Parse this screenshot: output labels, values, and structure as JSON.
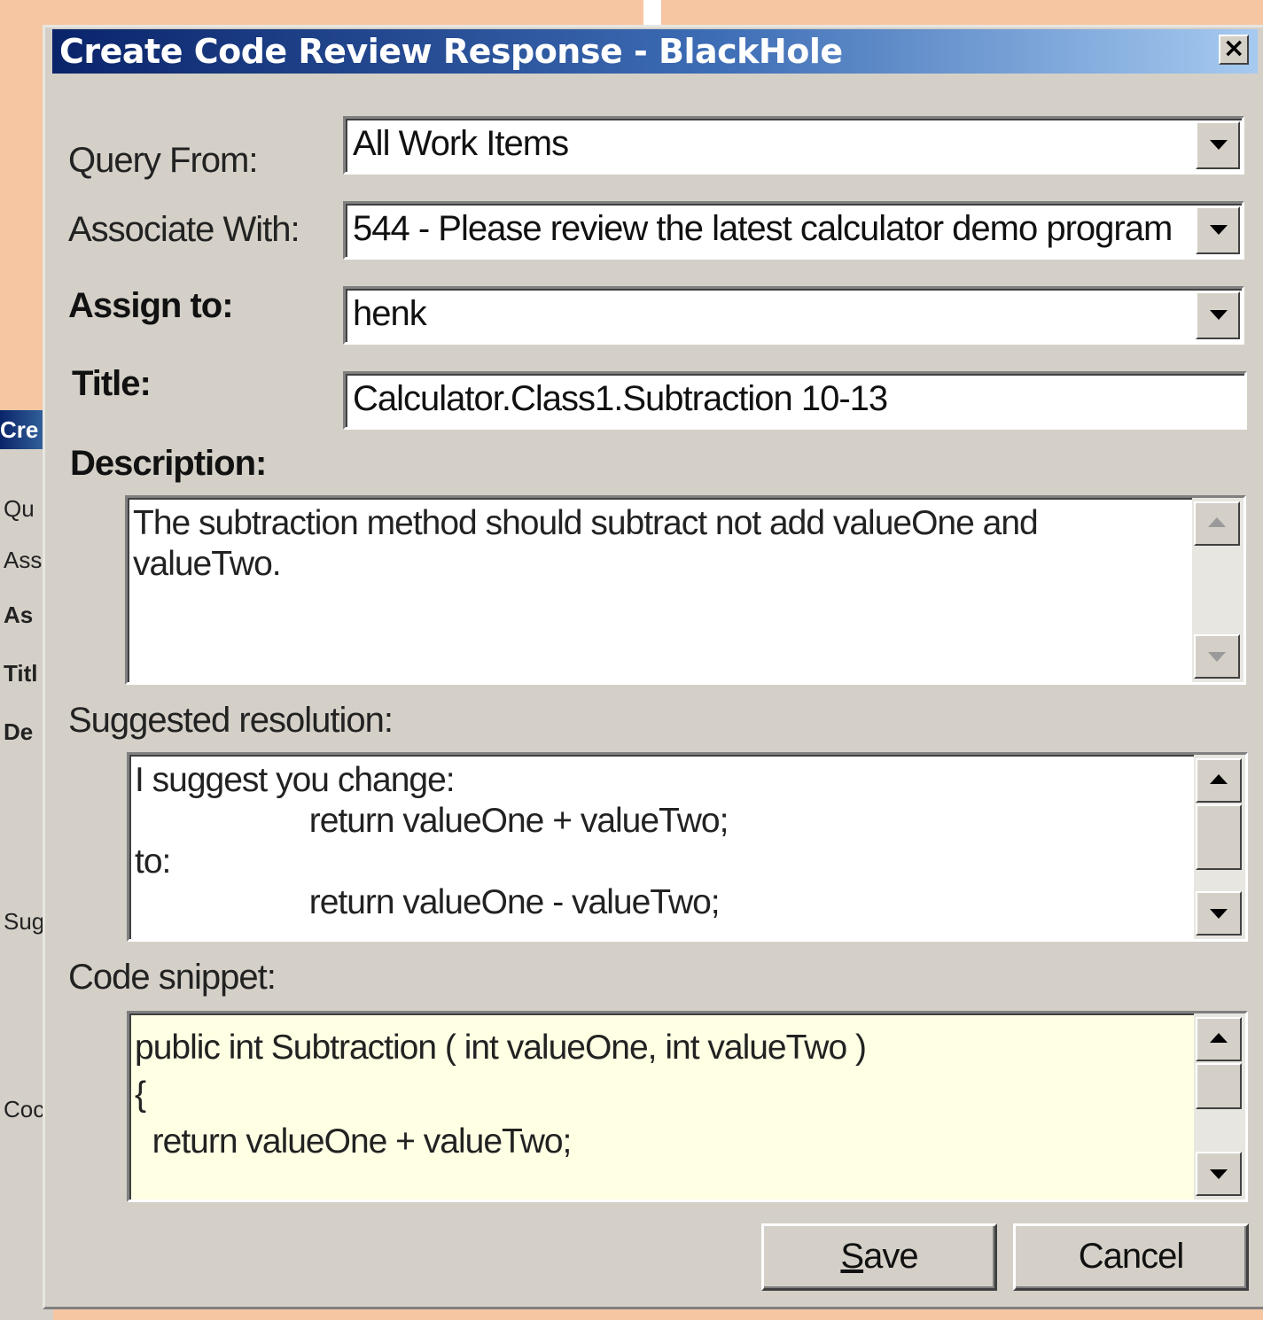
{
  "window": {
    "title": "Create Code Review Response - BlackHole",
    "close_glyph": "×"
  },
  "background_dialog": {
    "title": "Cre",
    "labels": [
      "Qu",
      "Ass",
      "As",
      "Titl",
      "De",
      "Sug",
      "Coc"
    ]
  },
  "form": {
    "query_from": {
      "label": "Query From:",
      "value": "All Work Items"
    },
    "associate_with": {
      "label": "Associate With:",
      "value": "544 - Please review the latest calculator demo program"
    },
    "assign_to": {
      "label": "Assign to:",
      "value": "henk"
    },
    "title": {
      "label": "Title:",
      "value": "Calculator.Class1.Subtraction 10-13"
    },
    "description": {
      "label": "Description:",
      "value": "The subtraction method should subtract not add valueOne and valueTwo."
    },
    "suggested_resolution": {
      "label": "Suggested resolution:",
      "value": "I suggest you change:\n                    return valueOne + valueTwo;\nto:\n                    return valueOne - valueTwo;"
    },
    "code_snippet": {
      "label": "Code snippet:",
      "value": "public int Subtraction ( int valueOne, int valueTwo )\n{\n  return valueOne + valueTwo;"
    }
  },
  "buttons": {
    "save_mnemonic": "S",
    "save_rest": "ave",
    "cancel": "Cancel"
  }
}
